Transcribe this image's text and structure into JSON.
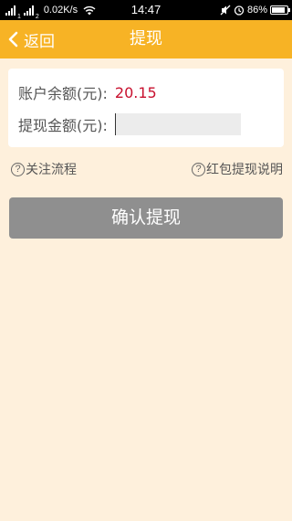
{
  "status_bar": {
    "sim1_tag": "1",
    "sim2_tag": "2",
    "net_speed": "0.02K/s",
    "time": "14:47",
    "battery_percent": "86%",
    "battery_level": 0.86
  },
  "header": {
    "back_label": "返回",
    "title": "提现"
  },
  "form": {
    "balance_label": "账户余额(元):",
    "balance_value": "20.15",
    "amount_label": "提现金额(元):",
    "amount_value": "",
    "amount_placeholder": ""
  },
  "links": {
    "follow_flow": "关注流程",
    "red_packet_help": "红包提现说明",
    "question_glyph": "?"
  },
  "actions": {
    "confirm_label": "确认提现"
  },
  "colors": {
    "header": "#f7b325",
    "background": "#fef0dc",
    "balance_value": "#c8102e",
    "confirm_button": "#8f8f8f"
  }
}
